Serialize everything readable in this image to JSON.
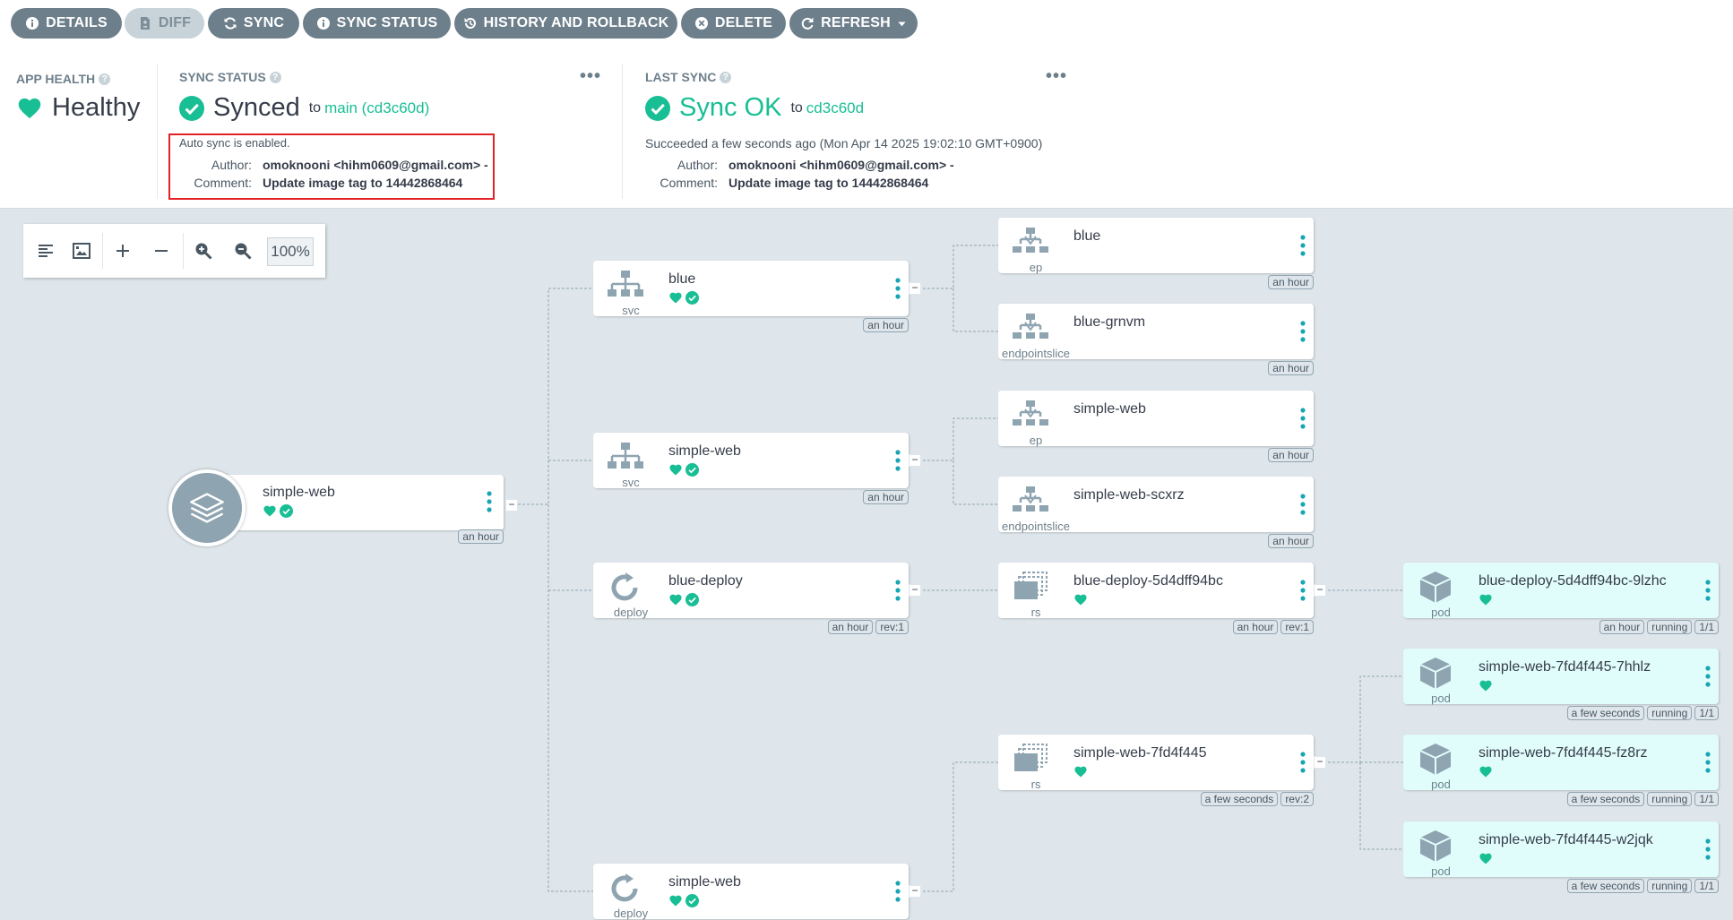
{
  "toolbar": {
    "buttons": [
      {
        "label": "DETAILS"
      },
      {
        "label": "DIFF"
      },
      {
        "label": "SYNC"
      },
      {
        "label": "SYNC STATUS"
      },
      {
        "label": "HISTORY AND ROLLBACK"
      },
      {
        "label": "DELETE"
      },
      {
        "label": "REFRESH"
      }
    ]
  },
  "app_health": {
    "title": "APP HEALTH",
    "value": "Healthy"
  },
  "sync_status": {
    "title": "SYNC STATUS",
    "value": "Synced",
    "to_label": "to",
    "revision": "main (cd3c60d)",
    "auto_sync": "Auto sync is enabled.",
    "author_label": "Author:",
    "author": "omoknooni <hihm0609@gmail.com> -",
    "comment_label": "Comment:",
    "comment": "Update image tag to 14442868464",
    "more": "•••"
  },
  "last_sync": {
    "title": "LAST SYNC",
    "value": "Sync OK",
    "to_label": "to",
    "revision": "cd3c60d",
    "succeeded": "Succeeded a few seconds ago (Mon Apr 14 2025 19:02:10 GMT+0900)",
    "author_label": "Author:",
    "author": "omoknooni <hihm0609@gmail.com> -",
    "comment_label": "Comment:",
    "comment": "Update image tag to 14442868464",
    "more": "•••"
  },
  "graph_tools": {
    "zoom": "100%"
  },
  "app_node": {
    "name": "simple-web",
    "age": "an hour"
  },
  "nodes": [
    {
      "name": "blue",
      "kind": "svc",
      "tags": [
        "an hour"
      ]
    },
    {
      "name": "simple-web",
      "kind": "svc",
      "tags": [
        "an hour"
      ]
    },
    {
      "name": "blue-deploy",
      "kind": "deploy",
      "tags": [
        "an hour",
        "rev:1"
      ]
    },
    {
      "name": "simple-web",
      "kind": "deploy",
      "tags": []
    },
    {
      "name": "blue",
      "kind": "ep",
      "tags": [
        "an hour"
      ]
    },
    {
      "name": "blue-grnvm",
      "kind": "endpointslice",
      "tags": [
        "an hour"
      ]
    },
    {
      "name": "simple-web",
      "kind": "ep",
      "tags": [
        "an hour"
      ]
    },
    {
      "name": "simple-web-scxrz",
      "kind": "endpointslice",
      "tags": [
        "an hour"
      ]
    },
    {
      "name": "blue-deploy-5d4dff94bc",
      "kind": "rs",
      "tags": [
        "an hour",
        "rev:1"
      ]
    },
    {
      "name": "simple-web-7fd4f445",
      "kind": "rs",
      "tags": [
        "a few seconds",
        "rev:2"
      ]
    },
    {
      "name": "blue-deploy-5d4dff94bc-9lzhc",
      "kind": "pod",
      "tags": [
        "an hour",
        "running",
        "1/1"
      ]
    },
    {
      "name": "simple-web-7fd4f445-7hhlz",
      "kind": "pod",
      "tags": [
        "a few seconds",
        "running",
        "1/1"
      ]
    },
    {
      "name": "simple-web-7fd4f445-fz8rz",
      "kind": "pod",
      "tags": [
        "a few seconds",
        "running",
        "1/1"
      ]
    },
    {
      "name": "simple-web-7fd4f445-w2jqk",
      "kind": "pod",
      "tags": [
        "a few seconds",
        "running",
        "1/1"
      ]
    }
  ]
}
